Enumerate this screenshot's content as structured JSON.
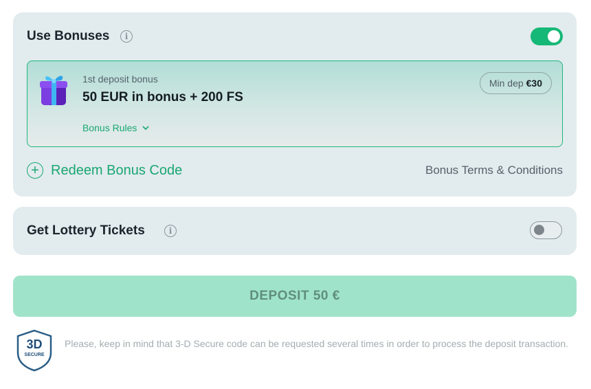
{
  "bonuses": {
    "title": "Use Bonuses",
    "info_icon": "info-icon",
    "toggle_on": true,
    "offer": {
      "subtitle": "1st deposit bonus",
      "title": "50 EUR in bonus + 200 FS",
      "rules_label": "Bonus Rules",
      "min_dep_label": "Min dep",
      "min_dep_value": "€30",
      "icon": "gift-icon"
    },
    "redeem_label": "Redeem Bonus Code",
    "terms_label": "Bonus Terms & Conditions"
  },
  "lottery": {
    "title": "Get Lottery Tickets",
    "toggle_on": false
  },
  "deposit_button_label": "DEPOSIT 50 €",
  "secure": {
    "badge_big": "3D",
    "badge_small": "SECURE",
    "note": "Please, keep in mind that 3-D Secure code can be requested several times in order to process the deposit transaction."
  },
  "colors": {
    "accent": "#16b877",
    "card_bg": "#e2ebee",
    "button_bg": "#a0e3cb"
  }
}
